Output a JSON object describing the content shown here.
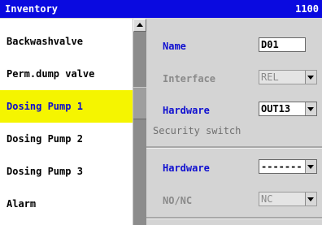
{
  "titlebar": {
    "title": "Inventory",
    "number": "1100"
  },
  "list": {
    "items": [
      {
        "label": "Backwashvalve"
      },
      {
        "label": "Perm.dump valve"
      },
      {
        "label": "Dosing Pump 1"
      },
      {
        "label": "Dosing Pump 2"
      },
      {
        "label": "Dosing Pump 3"
      },
      {
        "label": "Alarm"
      }
    ],
    "selected": "Dosing Pump 1"
  },
  "form": {
    "name_label": "Name",
    "name_value": "D01",
    "interface_label": "Interface",
    "interface_value": "REL",
    "hardware_label": "Hardware",
    "hardware_value": "OUT13",
    "security_section": "Security switch",
    "sec_hardware_label": "Hardware",
    "sec_hardware_value": "-------",
    "nonc_label": "NO/NC",
    "nonc_value": "NC"
  },
  "colors": {
    "titlebar": "#0a0ae0",
    "selection": "#f5f500",
    "label_blue": "#1010d0"
  },
  "icons": {
    "scroll_up": "triangle-up",
    "dropdown": "triangle-down"
  }
}
